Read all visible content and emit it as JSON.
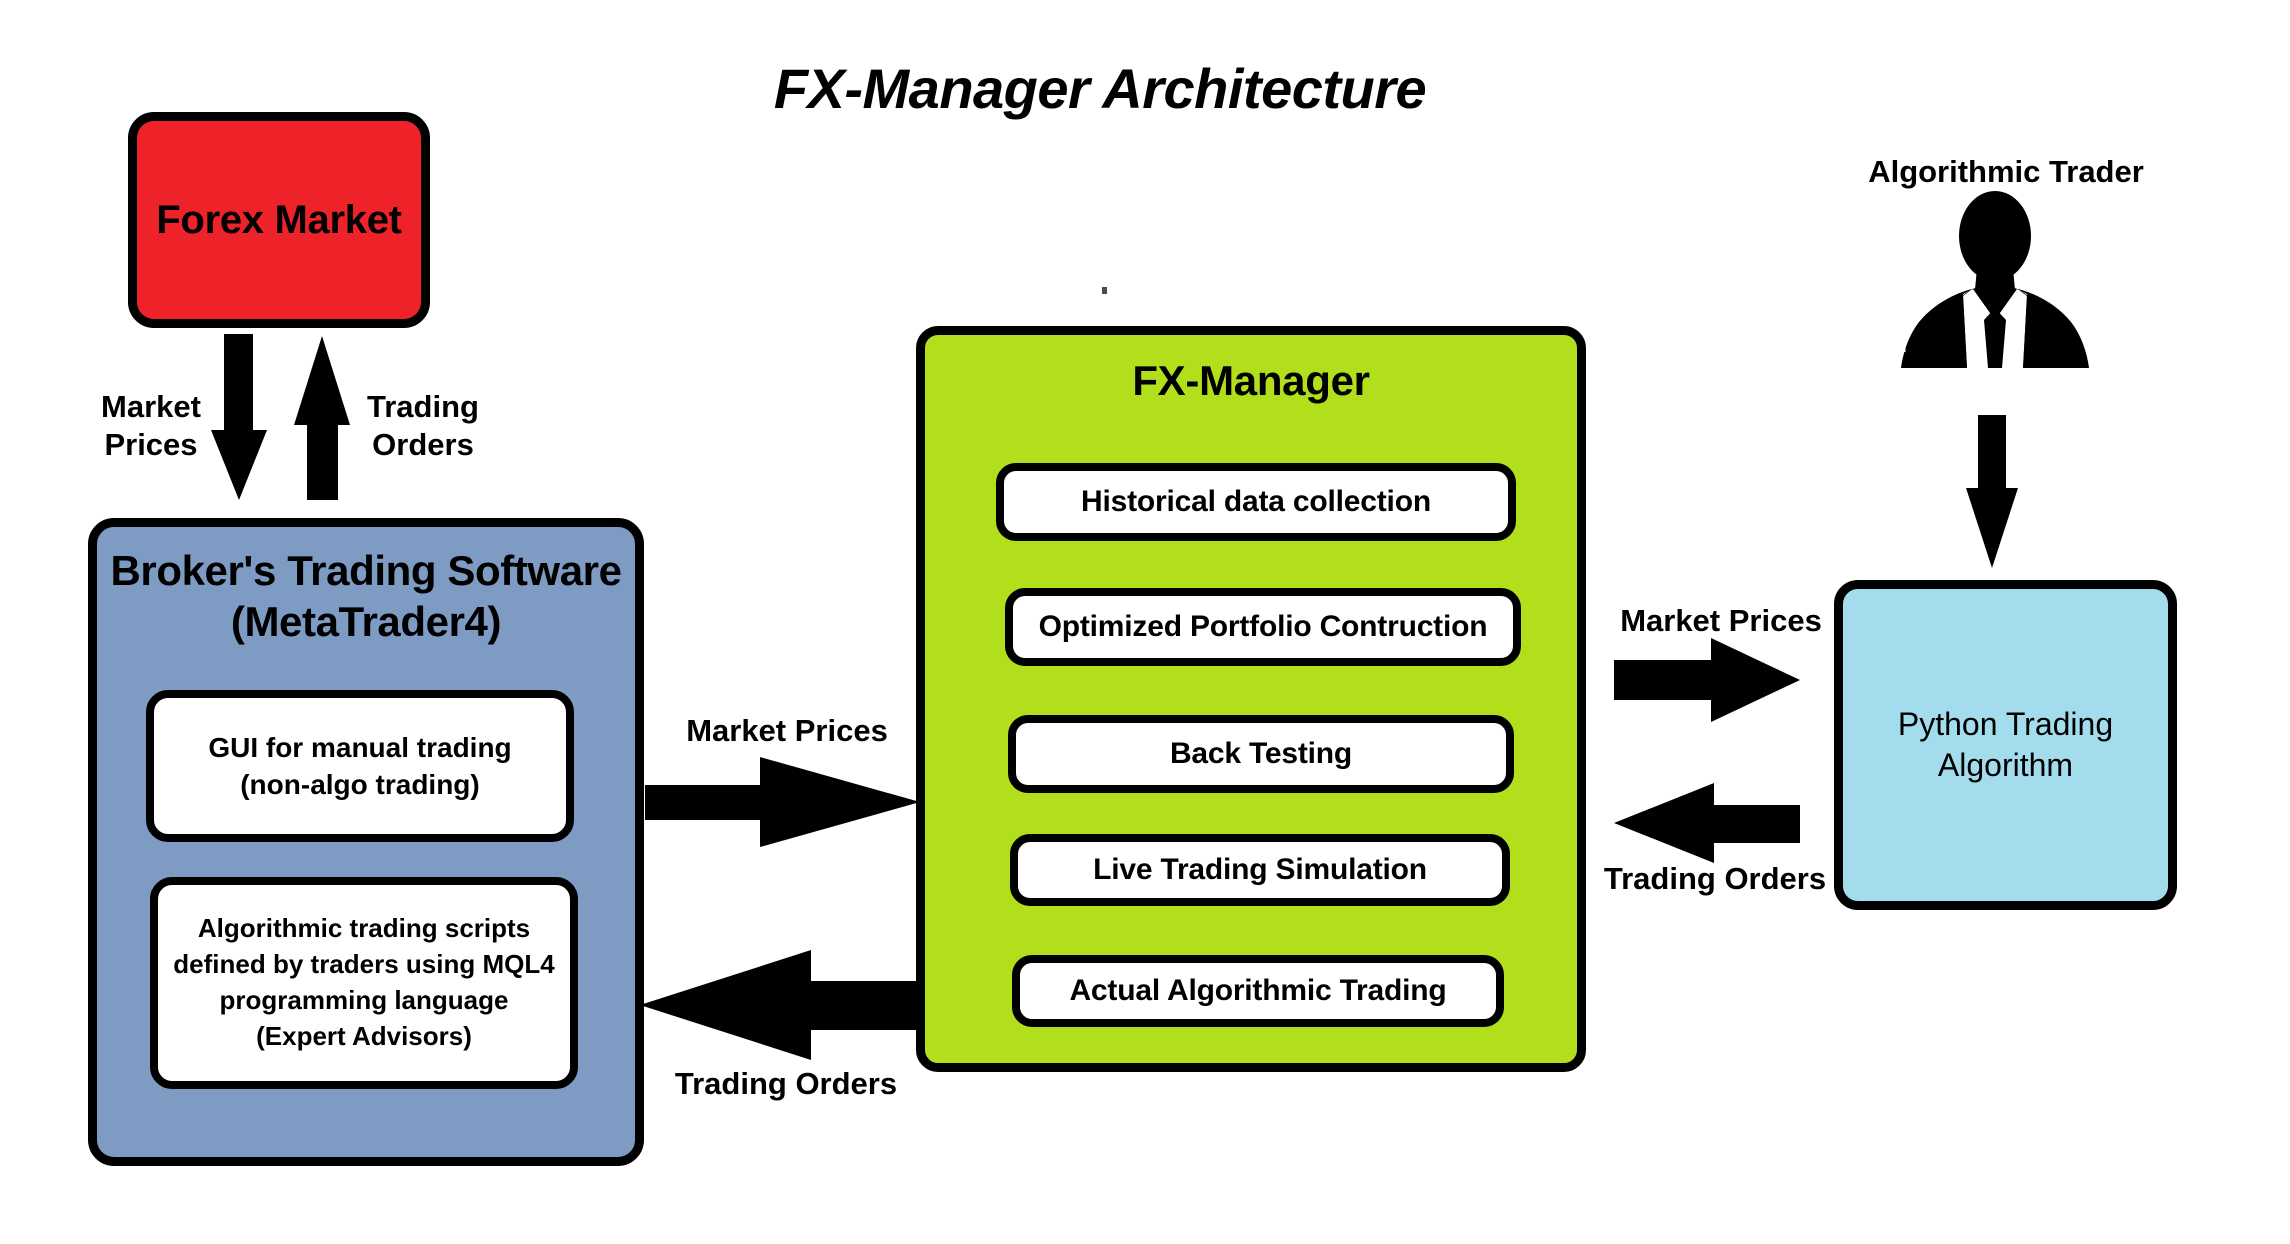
{
  "diagram": {
    "title": "FX-Manager Architecture"
  },
  "nodes": {
    "forex_market": {
      "label": "Forex Market",
      "color": "#EE2229"
    },
    "broker": {
      "label": "Broker's Trading Software\n(MetaTrader4)",
      "color": "#7E9BC4",
      "cards": [
        "GUI for manual trading\n(non-algo trading)",
        "Algorithmic trading scripts\ndefined by traders using MQL4\nprogramming language\n(Expert Advisors)"
      ]
    },
    "fx_manager": {
      "label": "FX-Manager",
      "color": "#B2DF1C",
      "cards": [
        "Historical data collection",
        "Optimized Portfolio Contruction",
        "Back Testing",
        "Live Trading Simulation",
        "Actual Algorithmic Trading"
      ]
    },
    "python_algorithm": {
      "label": "Python Trading\nAlgorithm",
      "color": "#A3DCEC"
    },
    "trader": {
      "label": "Algorithmic Trader",
      "icon": "businessman-silhouette-icon"
    }
  },
  "arrows": [
    {
      "name": "forex-to-broker",
      "label": "Market\nPrices",
      "direction": "down"
    },
    {
      "name": "broker-to-forex",
      "label": "Trading\nOrders",
      "direction": "up"
    },
    {
      "name": "broker-to-fxmanager",
      "label": "Market Prices",
      "direction": "right"
    },
    {
      "name": "fxmanager-to-broker",
      "label": "Trading Orders",
      "direction": "left"
    },
    {
      "name": "fxmanager-to-python",
      "label": "Market Prices",
      "direction": "right"
    },
    {
      "name": "python-to-fxmanager",
      "label": "Trading Orders",
      "direction": "left"
    },
    {
      "name": "trader-to-python",
      "label": "",
      "direction": "down"
    }
  ],
  "labels": {
    "market_prices_top": "Market\nPrices",
    "trading_orders_top": "Trading\nOrders",
    "market_prices_mid": "Market Prices",
    "trading_orders_mid": "Trading Orders",
    "market_prices_right": "Market Prices",
    "trading_orders_right": "Trading Orders"
  }
}
